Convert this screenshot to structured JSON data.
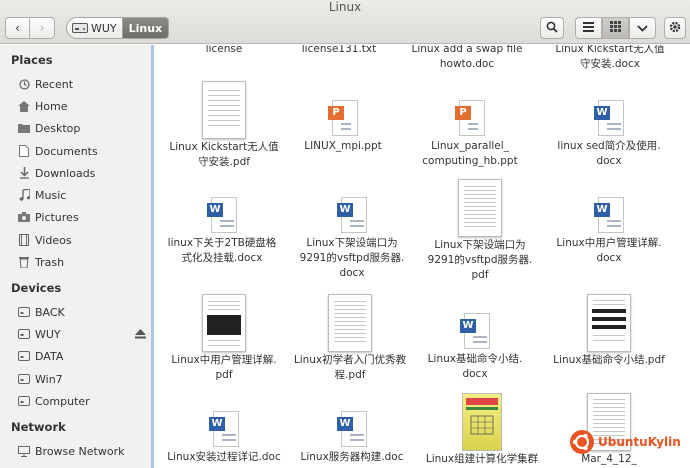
{
  "window": {
    "title": "Linux"
  },
  "toolbar": {
    "back_glyph": "‹",
    "forward_glyph": "›",
    "path": [
      {
        "label": "WUY",
        "icon": "drive-icon"
      },
      {
        "label": "Linux"
      }
    ],
    "search_icon": "search-icon",
    "view_icons": [
      "list-view-icon",
      "grid-view-icon",
      "chevron-down-icon"
    ],
    "settings_icon": "gear-icon"
  },
  "sidebar": {
    "places_heading": "Places",
    "places": [
      {
        "label": "Recent",
        "icon": "clock-icon"
      },
      {
        "label": "Home",
        "icon": "home-icon"
      },
      {
        "label": "Desktop",
        "icon": "folder-icon"
      },
      {
        "label": "Documents",
        "icon": "document-icon"
      },
      {
        "label": "Downloads",
        "icon": "download-icon"
      },
      {
        "label": "Music",
        "icon": "music-icon"
      },
      {
        "label": "Pictures",
        "icon": "camera-icon"
      },
      {
        "label": "Videos",
        "icon": "film-icon"
      },
      {
        "label": "Trash",
        "icon": "trash-icon"
      }
    ],
    "devices_heading": "Devices",
    "devices": [
      {
        "label": "BACK",
        "icon": "drive-icon"
      },
      {
        "label": "WUY",
        "icon": "drive-icon"
      },
      {
        "label": "DATA",
        "icon": "drive-icon"
      },
      {
        "label": "Win7",
        "icon": "drive-icon"
      },
      {
        "label": "Computer",
        "icon": "drive-icon"
      }
    ],
    "network_heading": "Network",
    "network": [
      {
        "label": "Browse Network",
        "icon": "network-icon"
      }
    ]
  },
  "files": [
    {
      "line1": "license",
      "line2": "",
      "type": "partial"
    },
    {
      "line1": "license131.txt",
      "line2": "",
      "type": "partial"
    },
    {
      "line1": "Linux add a swap file",
      "line2": "howto.doc",
      "type": "partial"
    },
    {
      "line1": "Linux Kickstart无人值",
      "line2": "守安装.docx",
      "type": "partial"
    },
    {
      "line1": "Linux Kickstart无人值",
      "line2": "守安装.pdf",
      "type": "pdf"
    },
    {
      "line1": "LINUX_mpi.ppt",
      "line2": "",
      "type": "ppt"
    },
    {
      "line1": "Linux_parallel_",
      "line2": "computing_hb.ppt",
      "type": "ppt"
    },
    {
      "line1": "linux sed简介及使用.",
      "line2": "docx",
      "type": "doc"
    },
    {
      "line1": "linux下关于2TB硬盘格",
      "line2": "式化及挂载.docx",
      "type": "doc"
    },
    {
      "line1": "Linux下架设端口为",
      "line2": "9291的vsftpd服务器.",
      "line3": "docx",
      "type": "doc"
    },
    {
      "line1": "Linux下架设端口为",
      "line2": "9291的vsftpd服务器.",
      "line3": "pdf",
      "type": "pdf"
    },
    {
      "line1": "Linux中用户管理详解.",
      "line2": "docx",
      "type": "doc"
    },
    {
      "line1": "Linux中用户管理详解.",
      "line2": "pdf",
      "type": "pdf-dark"
    },
    {
      "line1": "Linux初学者入门优秀教",
      "line2": "程.pdf",
      "type": "pdf"
    },
    {
      "line1": "Linux基础命令小结.",
      "line2": "docx",
      "type": "doc"
    },
    {
      "line1": "Linux基础命令小结.pdf",
      "line2": "",
      "type": "pdf-dark"
    },
    {
      "line1": "Linux安装过程详记.doc",
      "line2": "",
      "type": "doc"
    },
    {
      "line1": "Linux服务器构建.doc",
      "line2": "",
      "type": "doc"
    },
    {
      "line1": "Linux组建计算化学集群",
      "line2": "",
      "type": "book"
    },
    {
      "line1": "Mar_4_12_",
      "line2": "",
      "type": "pdf"
    }
  ],
  "watermark": {
    "text": "UbuntuKylin"
  },
  "colors": {
    "accent": "#a9c6e6",
    "ppt": "#e36e2f",
    "doc": "#2f5fa7",
    "brand": "#e95420"
  }
}
